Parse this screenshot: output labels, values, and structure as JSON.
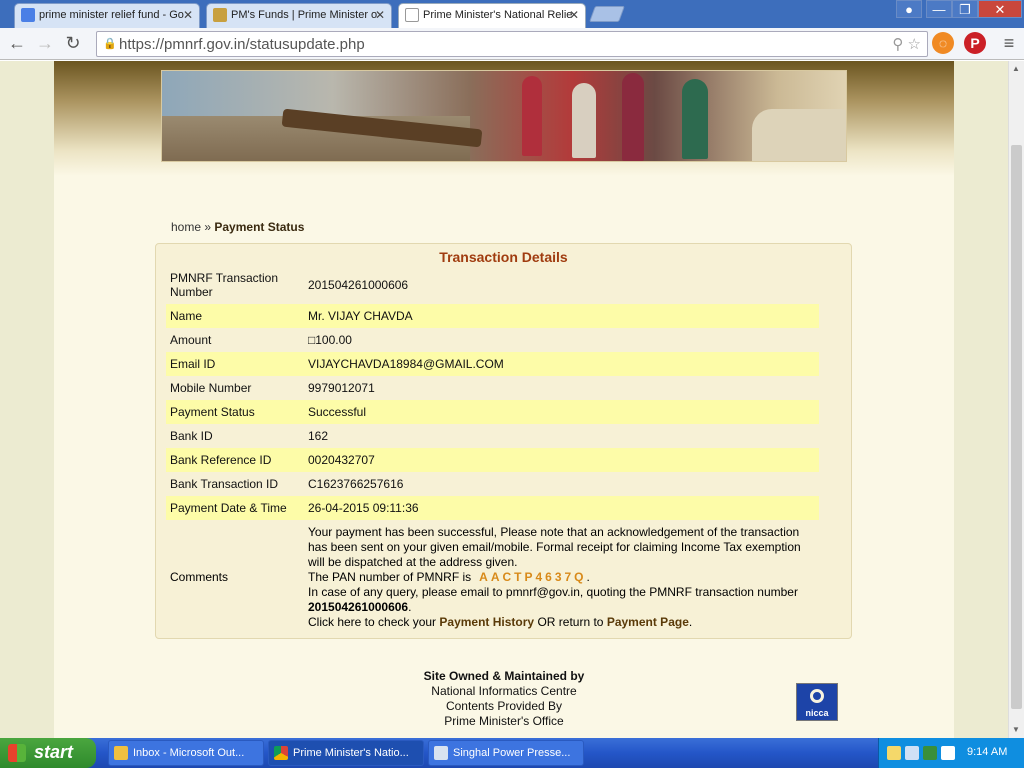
{
  "browser": {
    "tabs": [
      {
        "label": "prime minister relief fund - Go",
        "icon": "google-icon"
      },
      {
        "label": "PM's Funds | Prime Minister o",
        "icon": "emblem-icon"
      },
      {
        "label": "Prime Minister's National Relie",
        "icon": "page-icon"
      }
    ],
    "tab_close": "✕",
    "url": "https://pmnrf.gov.in/statusupdate.php",
    "window_buttons": [
      "—",
      "❐",
      "✕"
    ]
  },
  "breadcrumb": {
    "home": "home",
    "sep": " » ",
    "current": "Payment Status"
  },
  "transaction": {
    "title": "Transaction Details",
    "rows": [
      {
        "label": "PMNRF Transaction Number",
        "value": "201504261000606"
      },
      {
        "label": "Name",
        "value": "Mr. VIJAY CHAVDA"
      },
      {
        "label": "Amount",
        "value": "□100.00"
      },
      {
        "label": "Email ID",
        "value": "VIJAYCHAVDA18984@GMAIL.COM"
      },
      {
        "label": "Mobile Number",
        "value": "9979012071"
      },
      {
        "label": "Payment Status",
        "value": "Successful"
      },
      {
        "label": "Bank ID",
        "value": "162"
      },
      {
        "label": "Bank Reference ID",
        "value": "0020432707"
      },
      {
        "label": "Bank Transaction ID",
        "value": "C1623766257616"
      },
      {
        "label": "Payment Date & Time",
        "value": "26-04-2015 09:11:36"
      }
    ],
    "comments_label": "Comments",
    "comments": {
      "line1": "Your payment has been successful, Please note that an acknowledgement of the transaction has been sent on your given email/mobile. Formal receipt for claiming Income Tax exemption will be dispatched at the address given.",
      "pan_prefix": "The PAN number of PMNRF is",
      "pan": "AACTP4637Q",
      "pan_suffix": ".",
      "query": "In case of any query, please email to pmnrf@gov.in, quoting the PMNRF transaction number",
      "txn_number": "201504261000606",
      "txn_suffix": ".",
      "click_prefix": "Click here to check your",
      "history_link": "Payment History",
      "or_text": "OR return to",
      "payment_link": "Payment Page",
      "end": "."
    }
  },
  "footer": {
    "title": "Site Owned & Maintained by",
    "line1": "National Informatics Centre",
    "line2": "Contents Provided By",
    "line3": "Prime Minister's Office",
    "logo_text": "nicca"
  },
  "taskbar": {
    "start": "start",
    "items": [
      {
        "label": "Inbox - Microsoft Out...",
        "icon": "outlook-icon"
      },
      {
        "label": "Prime Minister's Natio...",
        "icon": "chrome-icon"
      },
      {
        "label": "Singhal Power Presse...",
        "icon": "app-icon"
      }
    ],
    "clock": "9:14 AM"
  },
  "colors": {
    "accent_title": "#a03c10",
    "highlight_row": "#fdfca8",
    "pan_color": "#d88a1a",
    "taskbar": "#2456c8"
  }
}
